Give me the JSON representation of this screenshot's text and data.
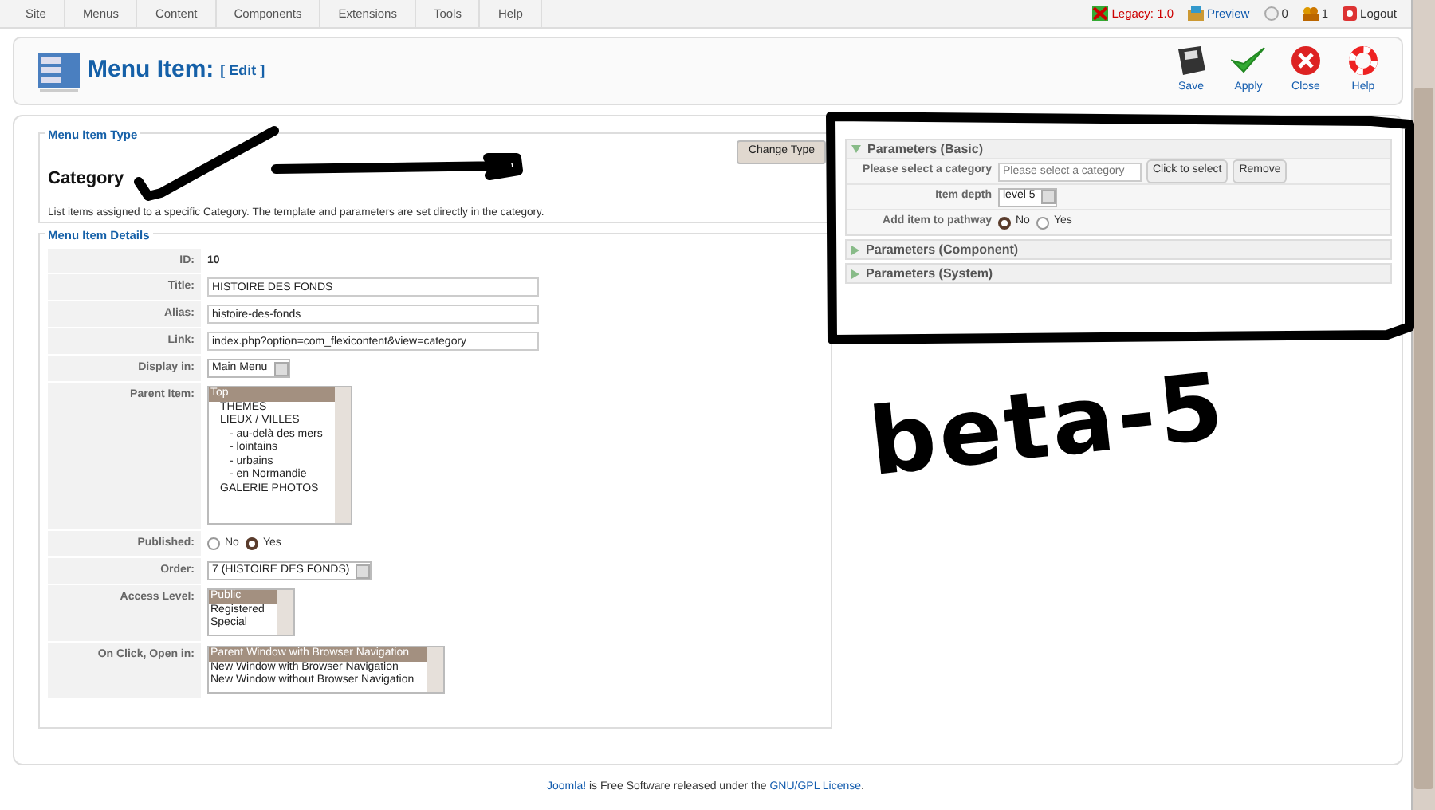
{
  "top_menu": [
    {
      "label": "Site"
    },
    {
      "label": "Menus"
    },
    {
      "label": "Content"
    },
    {
      "label": "Components"
    },
    {
      "label": "Extensions"
    },
    {
      "label": "Tools"
    },
    {
      "label": "Help"
    }
  ],
  "status_links": [
    {
      "kind": "legacy",
      "label": "Legacy: 1.0"
    },
    {
      "kind": "preview",
      "label": "Preview"
    },
    {
      "kind": "messages",
      "label": "0"
    },
    {
      "kind": "users",
      "label": "1"
    },
    {
      "kind": "logout",
      "label": "Logout"
    }
  ],
  "header": {
    "title": "Menu Item:",
    "subtitle": "[ Edit ]"
  },
  "toolbar": [
    {
      "kind": "save",
      "label": "Save"
    },
    {
      "kind": "apply",
      "label": "Apply"
    },
    {
      "kind": "close",
      "label": "Close"
    },
    {
      "kind": "help",
      "label": "Help"
    }
  ],
  "menu_item_type": {
    "legend": "Menu Item Type",
    "name": "Category",
    "description": "List items assigned to a specific Category. The template and parameters are set directly in the category.",
    "button": "Change Type"
  },
  "details": {
    "legend": "Menu Item Details",
    "rows": [
      {
        "kind": "static",
        "label": "ID:",
        "value": "10"
      },
      {
        "kind": "text",
        "label": "Title:",
        "value": "HISTOIRE DES FONDS"
      },
      {
        "kind": "text",
        "label": "Alias:",
        "value": "histoire-des-fonds"
      },
      {
        "kind": "text",
        "label": "Link:",
        "value": "index.php?option=com_flexicontent&view=category"
      },
      {
        "kind": "select",
        "label": "Display in:",
        "value": "Main Menu"
      },
      {
        "kind": "listbox",
        "label": "Parent Item:",
        "options": [
          {
            "label": "Top",
            "selected": true,
            "children": [
              {
                "label": "THEMES",
                "selected": false
              },
              {
                "label": "LIEUX / VILLES",
                "selected": false,
                "children": [
                  {
                    "label": "- au-delà des mers",
                    "selected": false
                  },
                  {
                    "label": "- lointains",
                    "selected": false
                  },
                  {
                    "label": "- urbains",
                    "selected": false
                  },
                  {
                    "label": "- en Normandie",
                    "selected": false
                  }
                ]
              },
              {
                "label": "GALERIE PHOTOS",
                "selected": false
              }
            ]
          }
        ]
      },
      {
        "kind": "radio",
        "label": "Published:",
        "options": [
          {
            "label": "No",
            "selected": false
          },
          {
            "label": "Yes",
            "selected": true
          }
        ]
      },
      {
        "kind": "select",
        "label": "Order:",
        "value": "7 (HISTOIRE DES FONDS)"
      },
      {
        "kind": "listbox",
        "label": "Access Level:",
        "options": [
          {
            "label": "Public",
            "selected": true
          },
          {
            "label": "Registered",
            "selected": false
          },
          {
            "label": "Special",
            "selected": false
          }
        ]
      },
      {
        "kind": "listbox",
        "label": "On Click, Open in:",
        "options": [
          {
            "label": "Parent Window with Browser Navigation",
            "selected": true
          },
          {
            "label": "New Window with Browser Navigation",
            "selected": false
          },
          {
            "label": "New Window without Browser Navigation",
            "selected": false
          }
        ]
      }
    ]
  },
  "parameters": [
    {
      "title": "Parameters (Basic)",
      "expanded": true,
      "rows": [
        {
          "kind": "category",
          "label": "Please select a category",
          "placeholder": "Please select a category",
          "buttons": [
            "Click to select",
            "Remove"
          ]
        },
        {
          "kind": "select",
          "label": "Item depth",
          "value": "level 5"
        },
        {
          "kind": "radio",
          "label": "Add item to pathway",
          "options": [
            {
              "label": "No",
              "selected": true
            },
            {
              "label": "Yes",
              "selected": false
            }
          ]
        }
      ]
    },
    {
      "title": "Parameters (Component)",
      "expanded": false
    },
    {
      "title": "Parameters (System)",
      "expanded": false
    }
  ],
  "annotation": {
    "note": "beta-5"
  },
  "footer": {
    "link": "Joomla!",
    "text": " is Free Software released under the ",
    "license": "GNU/GPL License",
    "end": "."
  }
}
